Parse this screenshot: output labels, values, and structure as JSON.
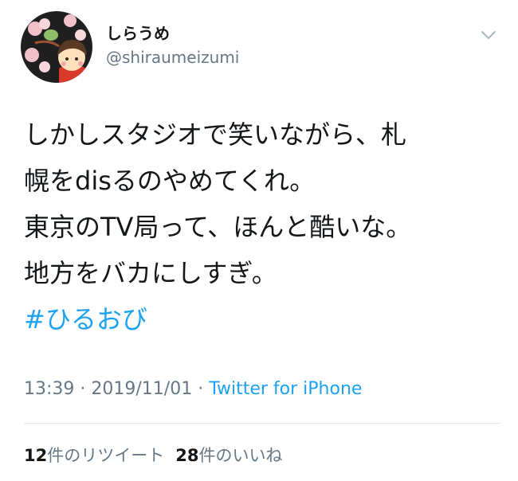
{
  "author": {
    "display_name": "しらうめ",
    "handle": "@shiraumeizumi"
  },
  "icons": {
    "more": "chevron-down-icon",
    "avatar": "avatar-illustration"
  },
  "tweet": {
    "lines": [
      "しかしスタジオで笑いながら、札",
      "幌をdisるのやめてくれ。",
      "東京のTV局って、ほんと酷いな。",
      "地方をバカにしすぎ。"
    ],
    "hashtag": "#ひるおび"
  },
  "meta": {
    "time": "13:39",
    "date": "2019/11/01",
    "separator": " · ",
    "source": "Twitter for iPhone"
  },
  "stats": {
    "retweets_count": "12",
    "retweets_label": "件のリツイート",
    "likes_count": "28",
    "likes_label": "件のいいね"
  },
  "colors": {
    "link": "#1da1f2",
    "secondary_text": "#657786",
    "primary_text": "#14171a",
    "divider": "#e1e8ed"
  }
}
